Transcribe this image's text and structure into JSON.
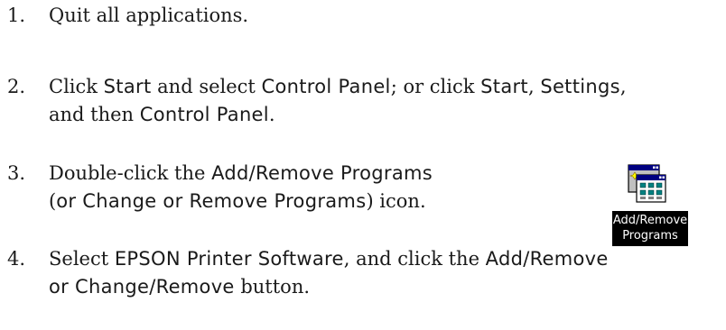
{
  "steps": [
    {
      "number": "1.",
      "lines": [
        [
          {
            "style": "serif",
            "text": "Quit all applications."
          }
        ]
      ]
    },
    {
      "number": "2.",
      "lines": [
        [
          {
            "style": "serif",
            "text": "Click "
          },
          {
            "style": "ui",
            "text": "Start"
          },
          {
            "style": "serif",
            "text": " and select "
          },
          {
            "style": "ui",
            "text": "Control Panel"
          },
          {
            "style": "serif",
            "text": "; or click "
          },
          {
            "style": "ui",
            "text": "Start"
          },
          {
            "style": "serif",
            "text": ", "
          },
          {
            "style": "ui",
            "text": "Settings"
          },
          {
            "style": "serif",
            "text": ","
          }
        ],
        [
          {
            "style": "serif",
            "text": "and then "
          },
          {
            "style": "ui",
            "text": "Control Panel"
          },
          {
            "style": "serif",
            "text": "."
          }
        ]
      ]
    },
    {
      "number": "3.",
      "lines": [
        [
          {
            "style": "serif",
            "text": "Double-click the "
          },
          {
            "style": "ui",
            "text": "Add/Remove Programs"
          }
        ],
        [
          {
            "style": "serif",
            "text": "("
          },
          {
            "style": "ui",
            "text": "or Change or Remove Programs"
          },
          {
            "style": "serif",
            "text": ") icon."
          }
        ]
      ]
    },
    {
      "number": "4.",
      "lines": [
        [
          {
            "style": "serif",
            "text": "Select "
          },
          {
            "style": "ui",
            "text": "EPSON Printer Software"
          },
          {
            "style": "serif",
            "text": ", and click the "
          },
          {
            "style": "ui",
            "text": "Add/Remove"
          }
        ],
        [
          {
            "style": "ui",
            "text": "or Change/Remove"
          },
          {
            "style": "serif",
            "text": " button."
          }
        ]
      ]
    }
  ],
  "icon": {
    "name": "add-remove-programs-icon",
    "label_line1": "Add/Remove",
    "label_line2": "Programs"
  }
}
